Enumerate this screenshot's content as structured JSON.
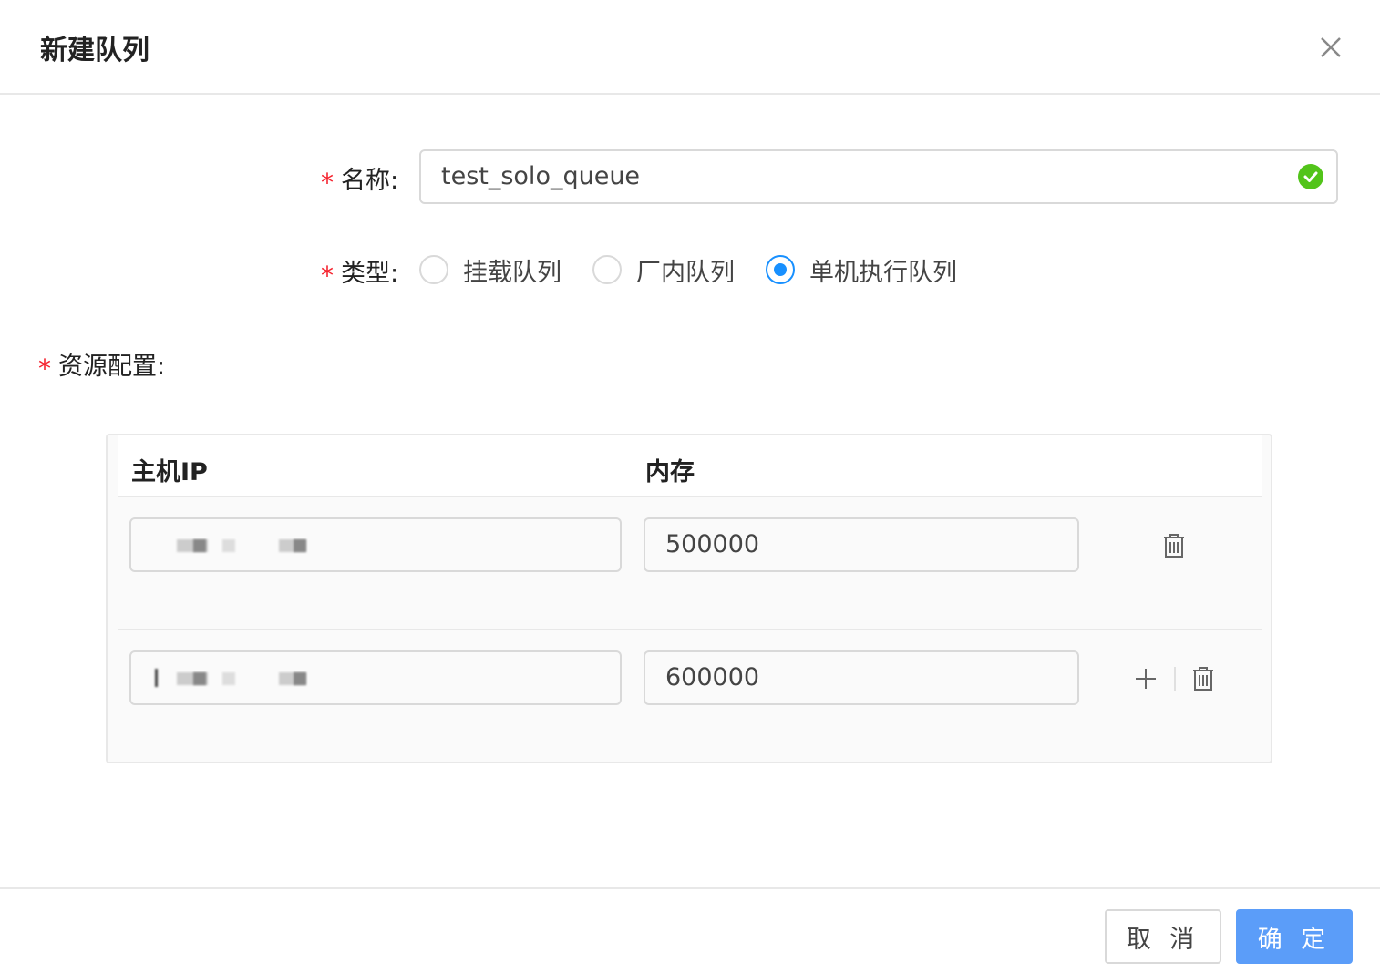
{
  "dialog": {
    "title": "新建队列"
  },
  "form": {
    "name_label": "名称:",
    "name_value": "test_solo_queue",
    "type_label": "类型:",
    "type_options": [
      "挂载队列",
      "厂内队列",
      "单机执行队列"
    ],
    "type_selected": "单机执行队列",
    "resource_label": "资源配置:"
  },
  "resource_table": {
    "columns": [
      "主机IP",
      "内存"
    ],
    "rows": [
      {
        "host_ip": "",
        "memory": "500000"
      },
      {
        "host_ip": "",
        "memory": "600000"
      }
    ]
  },
  "footer": {
    "cancel_label": "取 消",
    "ok_label": "确 定"
  },
  "colors": {
    "accent": "#1890ff",
    "primary_button": "#5b9df9",
    "required": "#f5222d",
    "valid": "#52c41a"
  },
  "icons": [
    "close-icon",
    "check-circle-icon",
    "trash-icon",
    "plus-icon"
  ]
}
